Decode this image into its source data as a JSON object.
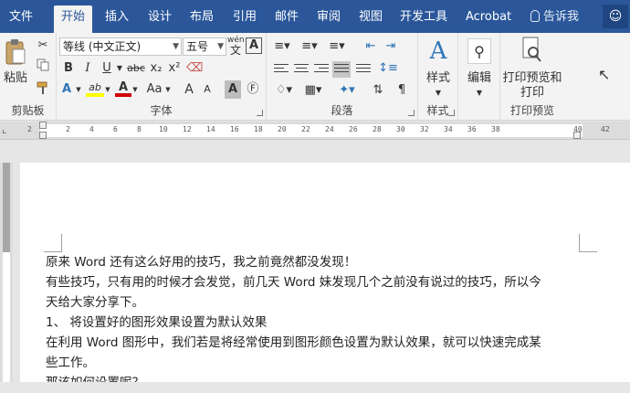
{
  "tabs": [
    {
      "label": "文件",
      "active": false
    },
    {
      "label": "开始",
      "active": true
    },
    {
      "label": "插入",
      "active": false
    },
    {
      "label": "设计",
      "active": false
    },
    {
      "label": "布局",
      "active": false
    },
    {
      "label": "引用",
      "active": false
    },
    {
      "label": "邮件",
      "active": false
    },
    {
      "label": "审阅",
      "active": false
    },
    {
      "label": "视图",
      "active": false
    },
    {
      "label": "开发工具",
      "active": false
    },
    {
      "label": "Acrobat",
      "active": false
    }
  ],
  "tell_me": "告诉我",
  "clipboard": {
    "paste_label": "粘贴",
    "group_label": "剪贴板"
  },
  "font": {
    "name": "等线 (中文正文)",
    "size": "五号",
    "group_label": "字体",
    "wen_label": "wén",
    "wen_char": "文",
    "bold": "B",
    "italic": "I",
    "underline": "U",
    "strike": "abc",
    "subscript": "x₂",
    "superscript": "x²",
    "font_color_letter": "A",
    "grow": "A",
    "shrink": "A",
    "case": "Aa",
    "highlight": "ab"
  },
  "paragraph": {
    "group_label": "段落"
  },
  "styles": {
    "label": "样式",
    "group_label": "样式"
  },
  "editing": {
    "label": "编辑"
  },
  "print_preview": {
    "label_line1": "打印预览和",
    "label_line2": "打印",
    "group_label": "打印预览"
  },
  "ruler": {
    "ticks": [
      "2",
      "2",
      "4",
      "6",
      "8",
      "10",
      "12",
      "14",
      "16",
      "18",
      "20",
      "22",
      "24",
      "26",
      "28",
      "30",
      "32",
      "34",
      "36",
      "38",
      "40",
      "42"
    ]
  },
  "document": {
    "paragraphs": [
      "原来 Word 还有这么好用的技巧，我之前竟然都没发现！",
      "有些技巧，只有用的时候才会发觉，前几天 Word 妹发现几个之前没有说过的技巧，所以今",
      "天给大家分享下。",
      "1、 将设置好的图形效果设置为默认效果",
      "在利用 Word 图形中，我们若是将经常使用到图形颜色设置为默认效果，就可以快速完成某",
      "些工作。",
      "那该如何设置呢？"
    ]
  },
  "colors": {
    "title_bar": "#2b579a",
    "ribbon": "#f3f3f3",
    "highlight_yellow": "#ffff00",
    "font_red": "#d00000"
  }
}
